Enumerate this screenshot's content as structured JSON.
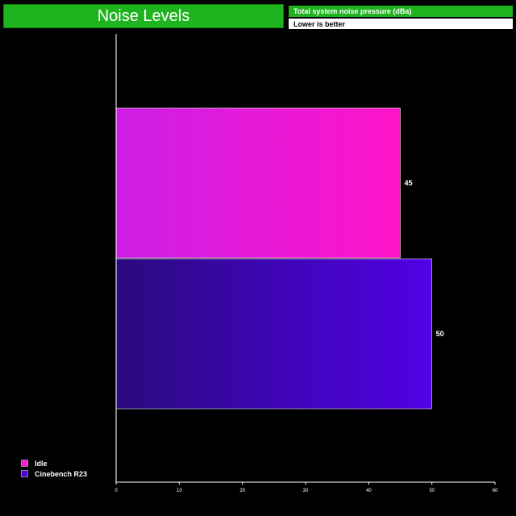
{
  "header": {
    "title": "Noise Levels",
    "subtitle": "Total system noise pressure (dBa)",
    "note": "Lower is better"
  },
  "chart_data": {
    "type": "bar",
    "orientation": "horizontal",
    "title": "Noise Levels",
    "xlabel": "",
    "ylabel": "",
    "xlim": [
      0,
      60
    ],
    "xticks": [
      0,
      10,
      20,
      30,
      40,
      50,
      60
    ],
    "grid": false,
    "legend_position": "bottom-left",
    "series": [
      {
        "name": "Idle",
        "values": [
          45
        ],
        "color": "#ff1ad9"
      },
      {
        "name": "Cinebench R23",
        "values": [
          50
        ],
        "color": "#4a00d6"
      }
    ]
  }
}
